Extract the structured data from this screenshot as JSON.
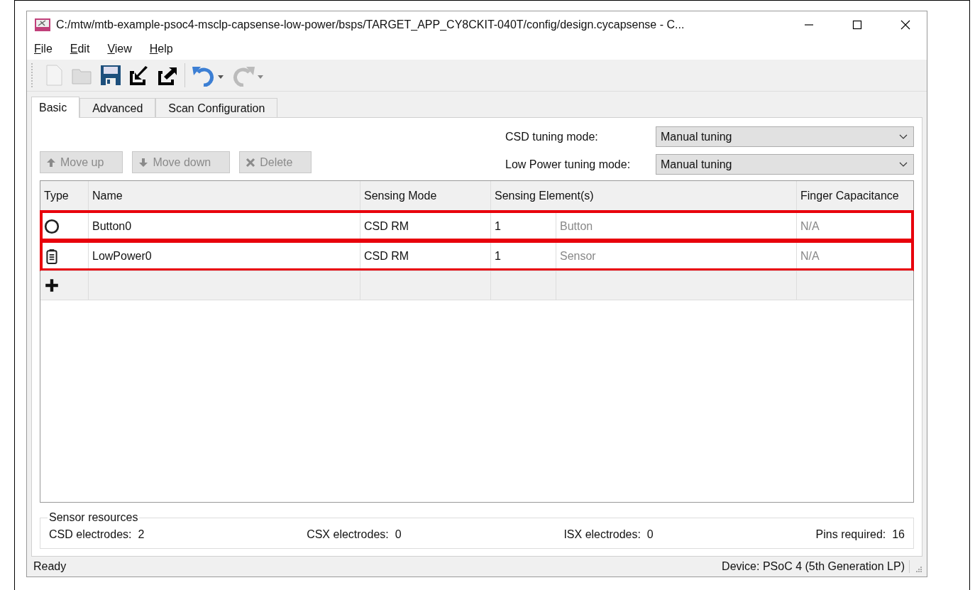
{
  "window": {
    "title": "C:/mtw/mtb-example-psoc4-msclp-capsense-low-power/bsps/TARGET_APP_CY8CKIT-040T/config/design.cycapsense - C..."
  },
  "menu": [
    {
      "label": "File"
    },
    {
      "label": "Edit"
    },
    {
      "label": "View"
    },
    {
      "label": "Help"
    }
  ],
  "toolbar": [
    {
      "kind": "new",
      "disabled": true
    },
    {
      "kind": "open",
      "disabled": true
    },
    {
      "kind": "save",
      "disabled": false
    },
    {
      "kind": "import",
      "disabled": false
    },
    {
      "kind": "export",
      "disabled": false
    },
    {
      "kind": "undo",
      "disabled": false
    },
    {
      "kind": "redo",
      "disabled": true
    }
  ],
  "tabs": [
    {
      "label": "Basic",
      "selected": true
    },
    {
      "label": "Advanced",
      "selected": false
    },
    {
      "label": "Scan Configuration",
      "selected": false
    }
  ],
  "buttons": [
    {
      "kind": "up",
      "label": "Move up",
      "disabled": true
    },
    {
      "kind": "down",
      "label": "Move down",
      "disabled": true
    },
    {
      "kind": "delete",
      "label": "Delete",
      "disabled": true
    }
  ],
  "tuning": [
    {
      "label": "CSD tuning mode:",
      "value": "Manual tuning"
    },
    {
      "label": "Low Power tuning mode:",
      "value": "Manual tuning"
    }
  ],
  "table": {
    "columns": [
      "Type",
      "Name",
      "Sensing Mode",
      "Sensing Element(s)",
      "Finger Capacitance"
    ],
    "rows": [
      {
        "kind": "button",
        "name": "Button0",
        "mode": "CSD RM",
        "count": "1",
        "element": "Button",
        "finger": "N/A",
        "highlighted": true
      },
      {
        "kind": "lowpower",
        "name": "LowPower0",
        "mode": "CSD RM",
        "count": "1",
        "element": "Sensor",
        "finger": "N/A",
        "highlighted": true
      }
    ]
  },
  "sensor_resources": {
    "title": "Sensor resources",
    "items": [
      {
        "label": "CSD electrodes:",
        "value": "2"
      },
      {
        "label": "CSX electrodes:",
        "value": "0"
      },
      {
        "label": "ISX electrodes:",
        "value": "0"
      },
      {
        "label": "Pins required:",
        "value": "16"
      }
    ]
  },
  "status_bar": {
    "left": "Ready",
    "right": "Device: PSoC 4 (5th Generation LP)"
  }
}
